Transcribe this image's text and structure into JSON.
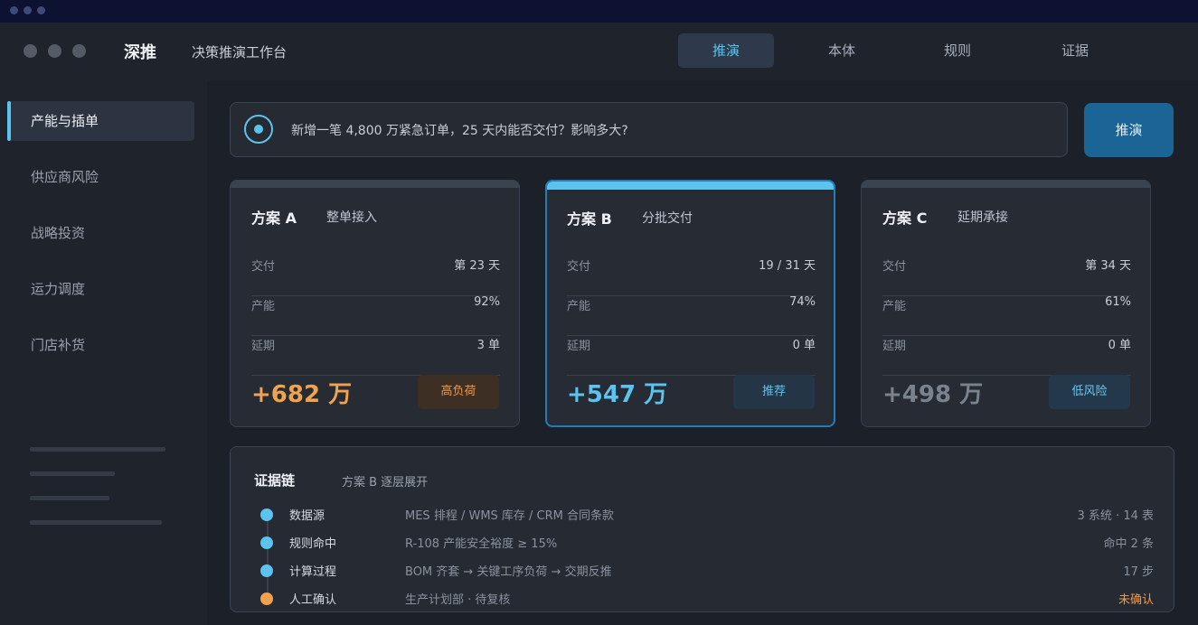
{
  "app": {
    "brand": "深推",
    "subtitle": "决策推演工作台"
  },
  "nav": {
    "tabs": [
      {
        "label": "推演",
        "active": true
      },
      {
        "label": "本体",
        "active": false
      },
      {
        "label": "规则",
        "active": false
      },
      {
        "label": "证据",
        "active": false
      }
    ]
  },
  "sidebar": {
    "items": [
      {
        "label": "产能与插单",
        "active": true
      },
      {
        "label": "供应商风险",
        "active": false
      },
      {
        "label": "战略投资",
        "active": false
      },
      {
        "label": "运力调度",
        "active": false
      },
      {
        "label": "门店补货",
        "active": false
      }
    ]
  },
  "query": {
    "text": "新增一笔 4,800 万紧急订单，25 天内能否交付？影响多大?",
    "run_label": "推演"
  },
  "scenarios": [
    {
      "name": "方案 A",
      "desc": "整单接入",
      "metrics": [
        {
          "label": "交付",
          "value": "第 23 天"
        },
        {
          "label": "产能",
          "value": "92%"
        },
        {
          "label": "延期",
          "value": "3 单"
        }
      ],
      "impact": "+682 万",
      "impact_color": "#f0a24e",
      "badge": "高负荷",
      "badge_bg": "#3e2f25",
      "badge_color": "#ef9a4a"
    },
    {
      "name": "方案 B",
      "desc": "分批交付",
      "metrics": [
        {
          "label": "交付",
          "value": "19 / 31 天"
        },
        {
          "label": "产能",
          "value": "74%"
        },
        {
          "label": "延期",
          "value": "0 单"
        }
      ],
      "impact": "+547 万",
      "impact_color": "#5cc3ef",
      "badge": "推荐",
      "badge_bg": "#243545",
      "badge_color": "#5cc3ef",
      "selected": true
    },
    {
      "name": "方案 C",
      "desc": "延期承接",
      "metrics": [
        {
          "label": "交付",
          "value": "第 34 天"
        },
        {
          "label": "产能",
          "value": "61%"
        },
        {
          "label": "延期",
          "value": "0 单"
        }
      ],
      "impact": "+498 万",
      "impact_color": "#7a828e",
      "badge": "低风险",
      "badge_bg": "#23394b",
      "badge_color": "#6fc6ee"
    }
  ],
  "evidence": {
    "title": "证据链",
    "subtitle": "方案 B 逐层展开",
    "steps": [
      {
        "name": "数据源",
        "desc": "MES 排程 / WMS 库存 / CRM 合同条款",
        "stat": "3 系统 · 14 表",
        "dot_color": "#5cc3ef",
        "stat_color": "#8a929e"
      },
      {
        "name": "规则命中",
        "desc": "R-108 产能安全裕度 ≥ 15%",
        "stat": "命中 2 条",
        "dot_color": "#5cc3ef",
        "stat_color": "#8a929e"
      },
      {
        "name": "计算过程",
        "desc": "BOM 齐套 → 关键工序负荷 → 交期反推",
        "stat": "17 步",
        "dot_color": "#5cc3ef",
        "stat_color": "#8a929e"
      },
      {
        "name": "人工确认",
        "desc": "生产计划部 · 待复核",
        "stat": "未确认",
        "dot_color": "#f0a24e",
        "stat_color": "#ef9a4a"
      }
    ]
  }
}
